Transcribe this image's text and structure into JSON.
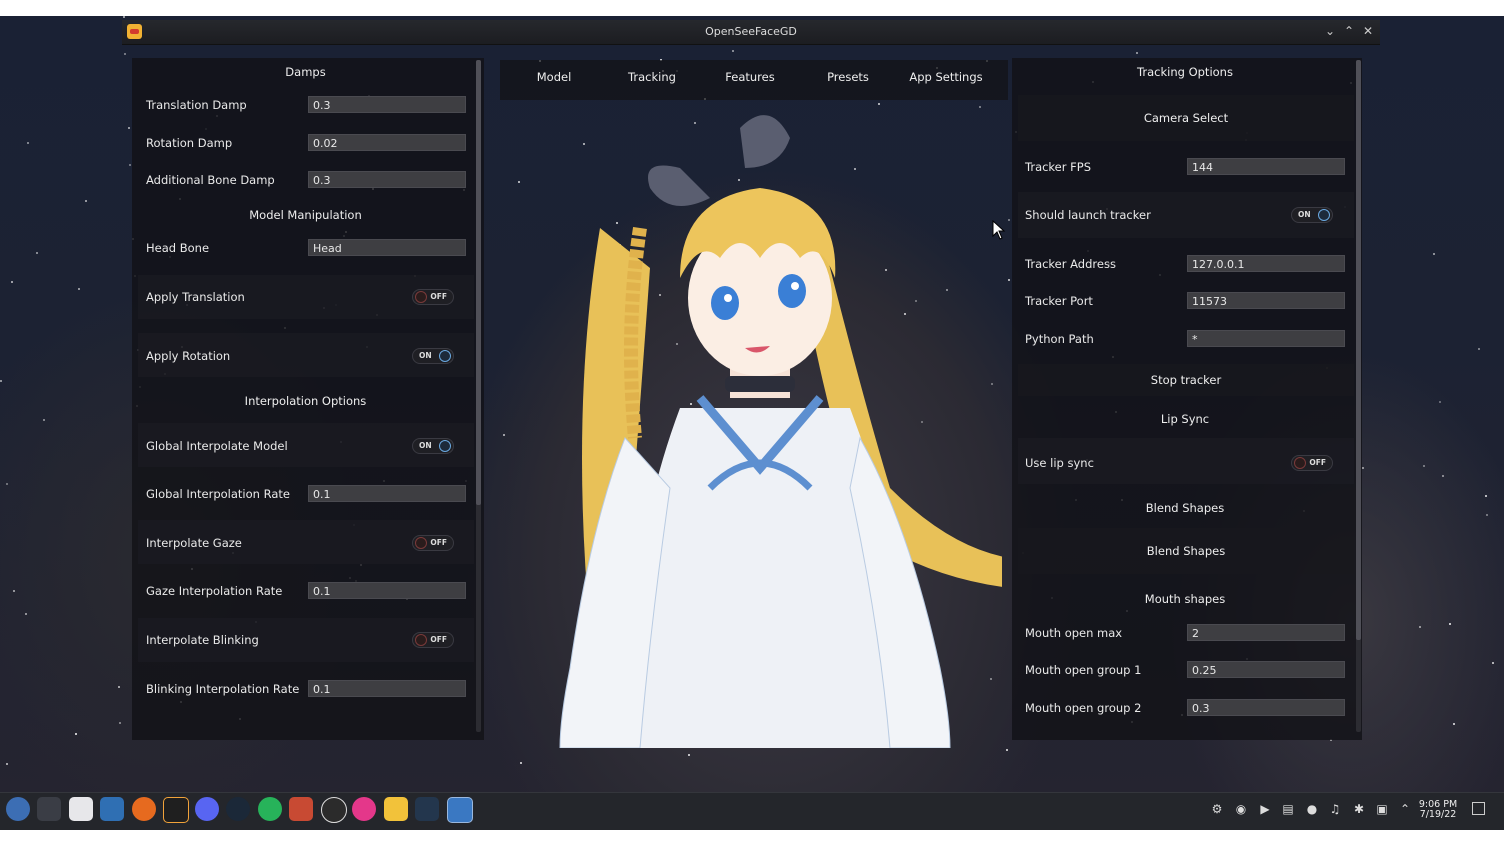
{
  "window": {
    "title": "OpenSeeFaceGD"
  },
  "left_panel": {
    "sections": {
      "damps": "Damps",
      "model_manipulation": "Model Manipulation",
      "interpolation_options": "Interpolation Options"
    },
    "rows": {
      "translation_damp": {
        "label": "Translation Damp",
        "value": "0.3"
      },
      "rotation_damp": {
        "label": "Rotation Damp",
        "value": "0.02"
      },
      "additional_bone_damp": {
        "label": "Additional Bone Damp",
        "value": "0.3"
      },
      "head_bone": {
        "label": "Head Bone",
        "value": "Head"
      },
      "apply_translation": {
        "label": "Apply Translation",
        "state": "OFF"
      },
      "apply_rotation": {
        "label": "Apply Rotation",
        "state": "ON"
      },
      "global_interpolate_model": {
        "label": "Global Interpolate Model",
        "state": "ON"
      },
      "global_interpolation_rate": {
        "label": "Global Interpolation Rate",
        "value": "0.1"
      },
      "interpolate_gaze": {
        "label": "Interpolate Gaze",
        "state": "OFF"
      },
      "gaze_interpolation_rate": {
        "label": "Gaze Interpolation Rate",
        "value": "0.1"
      },
      "interpolate_blinking": {
        "label": "Interpolate Blinking",
        "state": "OFF"
      },
      "blinking_interpolation_rate": {
        "label": "Blinking Interpolation Rate",
        "value": "0.1"
      }
    }
  },
  "tabs": [
    "Model",
    "Tracking",
    "Features",
    "Presets",
    "App Settings"
  ],
  "right_panel": {
    "title": "Tracking Options",
    "camera_select": "Camera Select",
    "rows": {
      "tracker_fps": {
        "label": "Tracker FPS",
        "value": "144"
      },
      "should_launch_tracker": {
        "label": "Should launch tracker",
        "state": "ON"
      },
      "tracker_address": {
        "label": "Tracker Address",
        "value": "127.0.0.1"
      },
      "tracker_port": {
        "label": "Tracker Port",
        "value": "11573"
      },
      "python_path": {
        "label": "Python Path",
        "value": "*"
      },
      "use_lip_sync": {
        "label": "Use lip sync",
        "state": "OFF"
      },
      "mouth_open_max": {
        "label": "Mouth open max",
        "value": "2"
      },
      "mouth_open_group_1": {
        "label": "Mouth open group 1",
        "value": "0.25"
      },
      "mouth_open_group_2": {
        "label": "Mouth open group 2",
        "value": "0.3"
      }
    },
    "stop_tracker": "Stop tracker",
    "lip_sync": "Lip Sync",
    "blend_shapes_header": "Blend Shapes",
    "blend_shapes_button": "Blend Shapes",
    "mouth_shapes": "Mouth shapes"
  },
  "taskbar": {
    "time": "9:06 PM",
    "date": "7/19/22",
    "apps": [
      "fedora-start-icon",
      "system-settings-icon",
      "store-icon",
      "file-manager-icon",
      "firefox-icon",
      "inkscape-icon",
      "discord-icon",
      "steam-icon",
      "sync-icon",
      "office-icon",
      "obs-icon",
      "krita-icon",
      "openseeface-icon",
      "vscode-icon",
      "godot-editor-icon"
    ]
  },
  "colors": {
    "accent": "#6aa8e0",
    "panel": "#141418",
    "field": "#3e3e42"
  }
}
